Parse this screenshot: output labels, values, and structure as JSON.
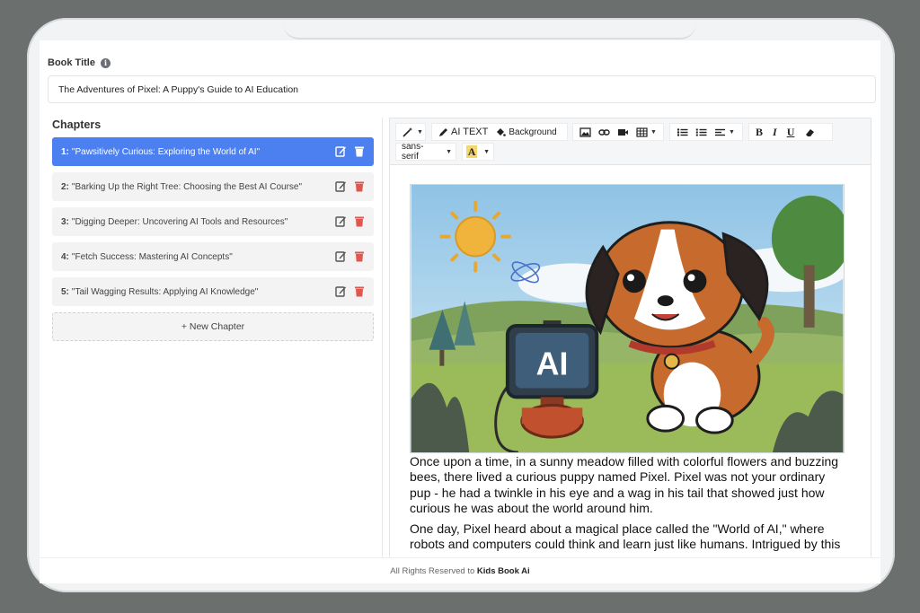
{
  "book_title": {
    "label": "Book Title",
    "value": "The Adventures of Pixel: A Puppy's Guide to AI Education"
  },
  "chapters": {
    "heading": "Chapters",
    "items": [
      {
        "num": "1:",
        "title": "\"Pawsitively Curious: Exploring the World of AI\"",
        "active": true
      },
      {
        "num": "2:",
        "title": "\"Barking Up the Right Tree: Choosing the Best AI Course\"",
        "active": false
      },
      {
        "num": "3:",
        "title": "\"Digging Deeper: Uncovering AI Tools and Resources\"",
        "active": false
      },
      {
        "num": "4:",
        "title": "\"Fetch Success: Mastering AI Concepts\"",
        "active": false
      },
      {
        "num": "5:",
        "title": "\"Tail Wagging Results: Applying AI Knowledge\"",
        "active": false
      }
    ],
    "new_chapter_label": "+ New Chapter"
  },
  "toolbar": {
    "ai_text_label": "AI TEXT",
    "background_label": "Background",
    "font_family": "sans-serif",
    "bold": "B",
    "italic": "I",
    "underline": "U",
    "font_color_letter": "A"
  },
  "illustration": {
    "screen_text": "AI"
  },
  "content": {
    "paragraphs": [
      "Once upon a time, in a sunny meadow filled with colorful flowers and buzzing bees, there lived a curious puppy named Pixel. Pixel was not your ordinary pup - he had a twinkle in his eye and a wag in his tail that showed just how curious he was about the world around him.",
      "One day, Pixel heard about a magical place called the \"World of AI,\" where robots and computers could think and learn just like humans. Intrigued by this"
    ]
  },
  "footer": {
    "text": "All Rights Reserved to",
    "brand": "Kids Book Ai"
  },
  "colors": {
    "accent": "#4c7ff0",
    "delete": "#e0574f",
    "background": "#6b706e"
  }
}
